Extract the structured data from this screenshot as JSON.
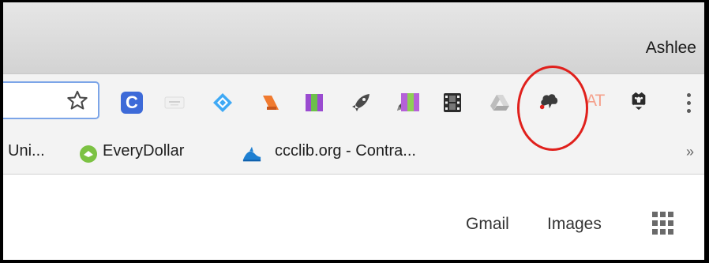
{
  "window": {
    "profile_name": "Ashlee"
  },
  "toolbar": {
    "star_icon": "star-icon",
    "extensions": [
      {
        "name": "extension-c",
        "label": "C",
        "color": "#3d6ad8"
      },
      {
        "name": "extension-blurred",
        "icon": "blurred-icon"
      },
      {
        "name": "extension-diamond",
        "icon": "diamond-icon",
        "color": "#3fa9f5"
      },
      {
        "name": "extension-orange-tag",
        "icon": "tag-icon",
        "color": "#f07a2f"
      },
      {
        "name": "extension-book",
        "icon": "book-icon",
        "colors": [
          "#9a4bd0",
          "#6cc04a"
        ]
      },
      {
        "name": "extension-rocket",
        "icon": "rocket-icon",
        "color": "#4a4a4a"
      },
      {
        "name": "extension-pencil",
        "icon": "pencil-icon",
        "color": "#4a4a4a"
      },
      {
        "name": "extension-book-2",
        "icon": "book-icon",
        "colors": [
          "#9a4bd0",
          "#6cc04a"
        ]
      },
      {
        "name": "extension-film",
        "icon": "film-icon",
        "color": "#2b2b2b"
      },
      {
        "name": "extension-drive",
        "icon": "drive-icon",
        "color": "#bdbdbd"
      },
      {
        "name": "extension-cloud",
        "icon": "cloud-icon",
        "color": "#3a3a3a"
      },
      {
        "name": "extension-at",
        "label": "AT",
        "color": "#f5a08b"
      },
      {
        "name": "extension-badger",
        "icon": "badger-icon",
        "color": "#2a2a2a"
      }
    ],
    "menu_icon": "three-dot-menu-icon",
    "highlight_color": "#e0201c"
  },
  "bookmarks": [
    {
      "label": "Uni...",
      "icon": "partial-icon"
    },
    {
      "label": "EveryDollar",
      "icon": "everydollar-icon"
    },
    {
      "label": "ccclib.org - Contra...",
      "icon": "ccclib-icon"
    }
  ],
  "bookmarks_overflow": "»",
  "content": {
    "gmail": "Gmail",
    "images": "Images",
    "apps_icon": "apps-grid-icon"
  }
}
